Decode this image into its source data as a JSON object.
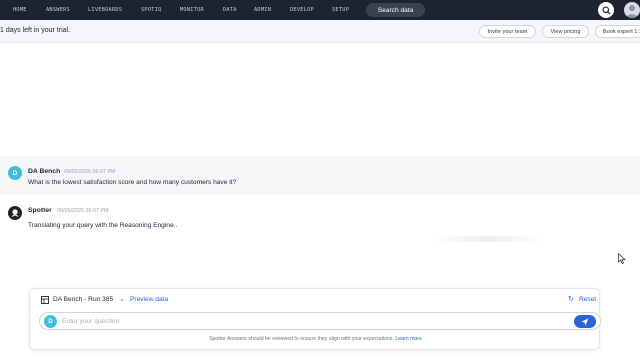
{
  "nav": {
    "items": [
      "HOME",
      "ANSWERS",
      "LIVEBOARDS",
      "SPOTIQ",
      "MONITOR",
      "DATA",
      "ADMIN",
      "DEVELOP",
      "SETUP"
    ],
    "search_label": "Search data"
  },
  "trial": {
    "message": "1 days left in your trial.",
    "invite_label": "Invite your team",
    "pricing_label": "View pricing",
    "expert_label": "Book expert 1:1"
  },
  "conversation": {
    "user": {
      "initial": "D",
      "name": "DA Bench",
      "timestamp": "09/05/2025 06:07 PM",
      "text": "What is the lowest satisfaction score and how many customers have it?"
    },
    "spotter": {
      "name": "Spotter",
      "timestamp": "09/05/2025 06:07 PM",
      "text": "Translating your query with the Reasoning Engine.."
    }
  },
  "composer": {
    "datasource": "DA Bench - Run 385",
    "preview_label": "Preview data",
    "reset_label": "Reset",
    "avatar_initial": "D",
    "placeholder": "Enter your question",
    "disclaimer": "Spotter Answers should be reviewed to ensure they align with your expectations.",
    "learn_more": "Learn more"
  },
  "colors": {
    "nav_bg": "#1d2430",
    "accent": "#2a62d9",
    "avatar": "#3fbedb"
  }
}
